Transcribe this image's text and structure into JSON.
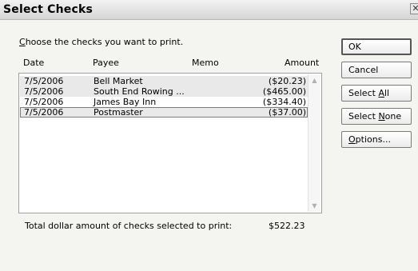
{
  "window": {
    "title": "Select Checks"
  },
  "instruction": {
    "mnemonic": "C",
    "rest": "hoose the checks you want to print."
  },
  "columns": {
    "date": "Date",
    "payee": "Payee",
    "memo": "Memo",
    "amount": "Amount"
  },
  "checks": [
    {
      "date": "7/5/2006",
      "payee": "Bell Market",
      "amount": "($20.23)",
      "selected": true
    },
    {
      "date": "7/5/2006",
      "payee": "South End Rowing ...",
      "amount": "($465.00)",
      "selected": true
    },
    {
      "date": "7/5/2006",
      "payee": "James Bay Inn",
      "amount": "($334.40)",
      "selected": false
    },
    {
      "date": "7/5/2006",
      "payee": "Postmaster",
      "amount": "($37.00)",
      "selected": true
    }
  ],
  "buttons": {
    "ok": "OK",
    "cancel": "Cancel",
    "select_all": {
      "pre": "Select ",
      "mnemonic": "A",
      "post": "ll"
    },
    "select_none": {
      "pre": "Select ",
      "mnemonic": "N",
      "post": "one"
    },
    "options": {
      "pre": "",
      "mnemonic": "O",
      "post": "ptions..."
    }
  },
  "total": {
    "label": "Total dollar amount of checks selected to print:",
    "value": "$522.23"
  },
  "icons": {
    "close": "close-icon",
    "scroll_up": "scroll-up-arrow-icon",
    "scroll_down": "scroll-down-arrow-icon"
  }
}
